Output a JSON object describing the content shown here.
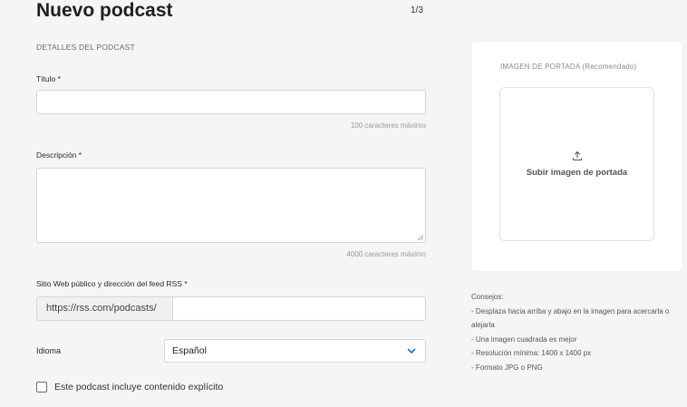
{
  "header": {
    "title": "Nuevo podcast",
    "step": "1/3"
  },
  "form": {
    "section_label": "DETALLES DEL PODCAST",
    "title_label": "Título",
    "title_hint": "100 caracteres máximo",
    "description_label": "Descripción",
    "description_hint": "4000 caracteres máximo",
    "rss_label": "Sitio Web público y dirección del feed RSS",
    "rss_prefix": "https://rss.com/podcasts/",
    "language_label": "Idioma",
    "language_value": "Español",
    "explicit_label": "Este podcast incluye contenido explícito",
    "required_mark": "*"
  },
  "cover": {
    "title": "IMAGEN DE PORTADA  (Recomendado)",
    "upload_label": "Subir imagen de portada"
  },
  "tips": {
    "heading": "Consejos:",
    "items": [
      "- Desplaza hacia arriba y abajo en la imagen para acercarla o alejarla",
      "- Una imagen cuadrada es mejor",
      "- Resolución mínima: 1400 x 1400 px",
      "- Formato JPG o PNG"
    ]
  },
  "colors": {
    "accent": "#1f6fe0",
    "background": "#f5f5f6"
  }
}
